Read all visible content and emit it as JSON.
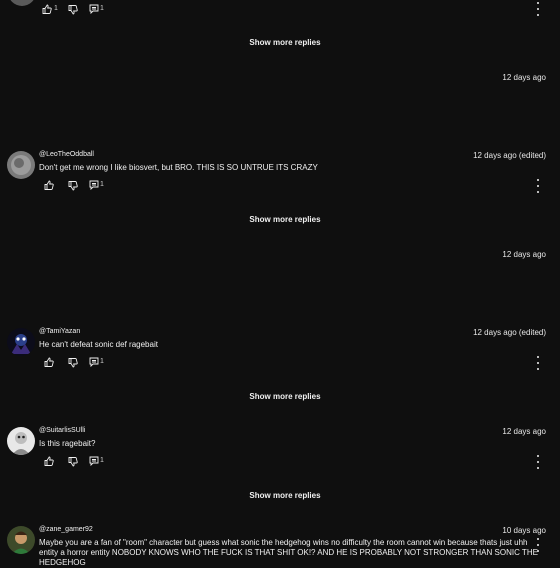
{
  "top": {
    "likes": "1",
    "replies": "1",
    "show_more": "Show more replies"
  },
  "timestamps": {
    "t1": "12 days ago",
    "t2": "12 days ago"
  },
  "comments": [
    {
      "handle": "@LeoTheOddball",
      "time": "12 days ago (edited)",
      "text": "Don't get me wrong I like biosvert, but BRO. THIS IS SO UNTRUE ITS CRAZY",
      "replies": "1",
      "show_more": "Show more replies"
    },
    {
      "handle": "@TamiYazan",
      "time": "12 days ago (edited)",
      "text": "He can't defeat sonic def ragebait",
      "replies": "1",
      "show_more": "Show more replies"
    },
    {
      "handle": "@SuitarlisSUlli",
      "time": "12 days ago",
      "text": "Is this ragebait?",
      "replies": "1",
      "show_more": "Show more replies"
    },
    {
      "handle": "@zane_gamer92",
      "time": "10 days ago",
      "text_line1": "Maybe you are a fan of \"room\" character but guess what sonic the hedgehog wins no difficulty the room cannot win because thats just uhh",
      "text_line2": "entity a horror entity NOBODY KNOWS WHO THE FUCK IS THAT SHIT OK!? AND HE IS PROBABLY NOT STRONGER THAN SONIC THE",
      "text_line3": "HEDGEHOG"
    }
  ],
  "icons": {
    "like": "thumbs-up-icon",
    "dislike": "thumbs-down-icon",
    "reply": "reply-icon",
    "more": "kebab-menu-icon"
  },
  "colors": {
    "background": "#0f0f0f",
    "text": "#f1f1f1"
  }
}
